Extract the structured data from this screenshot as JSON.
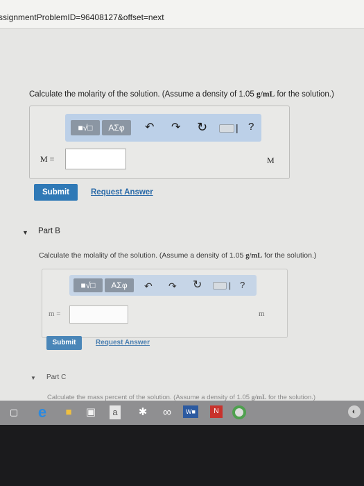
{
  "browser": {
    "url": "ssignmentProblemID=96408127&offset=next"
  },
  "part_a": {
    "question_prefix": "Calculate the molarity of the solution. (Assume a density of 1.05 ",
    "question_unit": "g/mL",
    "question_suffix": " for the solution.)",
    "toolbar": {
      "radical_label": "■√□",
      "greek_label": "ΑΣφ",
      "help_label": "?"
    },
    "variable": "M =",
    "unit": "M",
    "input_value": "",
    "submit_label": "Submit",
    "request_label": "Request Answer"
  },
  "part_b": {
    "title": "Part B",
    "question_prefix": "Calculate the molality of the solution. (Assume a density of 1.05 ",
    "question_unit": "g/mL",
    "question_suffix": " for the solution.)",
    "toolbar": {
      "radical_label": "■√□",
      "greek_label": "ΑΣφ",
      "help_label": "?"
    },
    "variable": "m =",
    "unit": "m",
    "input_value": "",
    "submit_label": "Submit",
    "request_label": "Request Answer"
  },
  "part_c": {
    "title": "Part C",
    "question_prefix": "Calculate the mass percent of the solution. (Assume a density of 1.05 ",
    "question_unit": "g/mL",
    "question_suffix": " for the solution.)"
  },
  "taskbar": {
    "store_label": "a"
  }
}
